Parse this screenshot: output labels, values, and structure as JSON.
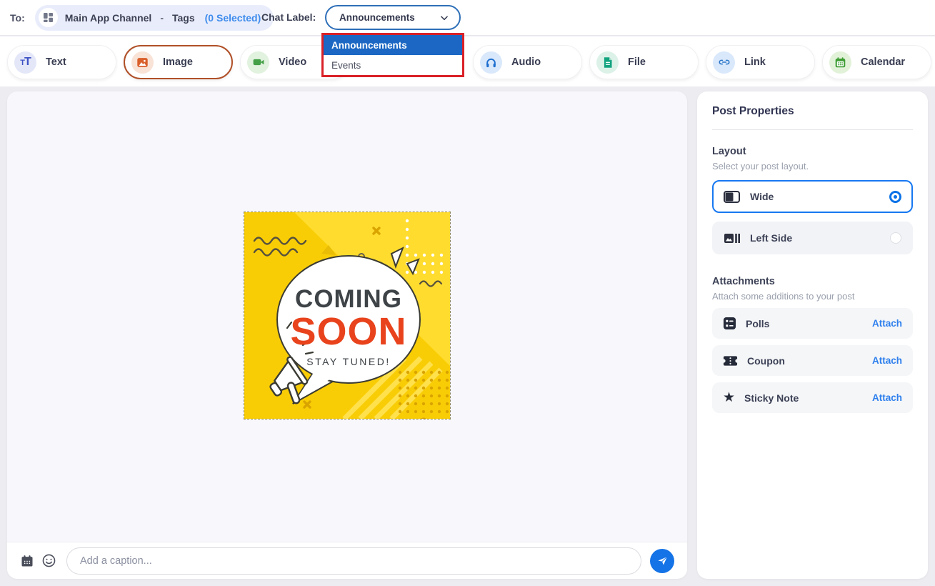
{
  "topbar": {
    "to_label": "To:",
    "channel": {
      "name": "Main App Channel",
      "separator": "-",
      "tags_label": "Tags",
      "tags_count": "(0 Selected)"
    },
    "chat_label": "Chat Label:",
    "dropdown": {
      "value": "Announcements",
      "options": [
        {
          "label": "Announcements",
          "highlighted": true
        },
        {
          "label": "Events",
          "highlighted": false
        }
      ]
    }
  },
  "toolbar": {
    "items": [
      {
        "label": "Text",
        "selected": false
      },
      {
        "label": "Image",
        "selected": true
      },
      {
        "label": "Video",
        "selected": false
      },
      {
        "label": "Audio",
        "selected": false
      },
      {
        "label": "File",
        "selected": false
      },
      {
        "label": "Link",
        "selected": false
      },
      {
        "label": "Calendar",
        "selected": false
      }
    ]
  },
  "canvas": {
    "image": {
      "title_line1": "COMING",
      "title_line2": "SOON",
      "subtitle": "STAY TUNED!"
    },
    "caption": {
      "placeholder": "Add a caption..."
    }
  },
  "sidebar": {
    "title": "Post Properties",
    "layout": {
      "heading": "Layout",
      "subheading": "Select your post layout.",
      "options": [
        {
          "label": "Wide",
          "selected": true
        },
        {
          "label": "Left Side",
          "selected": false
        }
      ]
    },
    "attachments": {
      "heading": "Attachments",
      "subheading": "Attach some additions to your post",
      "items": [
        {
          "label": "Polls",
          "action": "Attach"
        },
        {
          "label": "Coupon",
          "action": "Attach"
        },
        {
          "label": "Sticky Note",
          "action": "Attach"
        }
      ]
    }
  },
  "colors": {
    "accent_blue": "#1778f2",
    "selected_tool_border": "#b05028",
    "dropdown_highlight": "#1b67c3",
    "dropdown_alert_border": "#d92127",
    "attach_link": "#2f80ed",
    "send_button": "#1473e6",
    "image_bg_yellow": "#f9cd06",
    "image_soon_red": "#e8431c"
  }
}
